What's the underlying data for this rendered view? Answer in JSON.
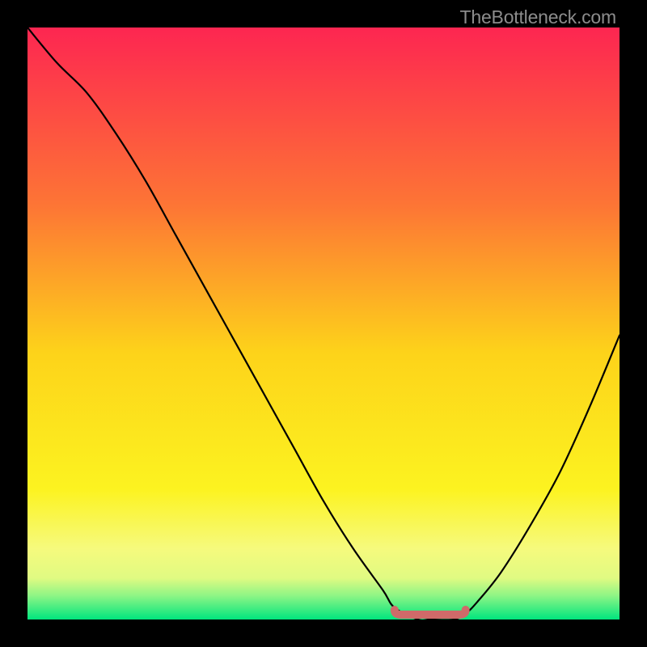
{
  "watermark": "TheBottleneck.com",
  "chart_data": {
    "type": "line",
    "title": "",
    "xlabel": "",
    "ylabel": "",
    "xlim": [
      0,
      100
    ],
    "ylim": [
      0,
      100
    ],
    "x": [
      0,
      5,
      10,
      15,
      20,
      25,
      30,
      35,
      40,
      45,
      50,
      55,
      60,
      62,
      66,
      68,
      72,
      74,
      76,
      80,
      85,
      90,
      95,
      100
    ],
    "y": [
      100,
      94,
      89,
      82,
      74,
      65,
      56,
      47,
      38,
      29,
      20,
      12,
      5,
      2,
      0,
      0,
      0,
      1,
      3,
      8,
      16,
      25,
      36,
      48
    ],
    "flat_region": {
      "x_start": 62,
      "x_end": 74,
      "y": 0
    },
    "background_gradient_top_to_bottom": [
      {
        "stop": 0.0,
        "color": "#fd2651"
      },
      {
        "stop": 0.3,
        "color": "#fd7535"
      },
      {
        "stop": 0.55,
        "color": "#fdd31a"
      },
      {
        "stop": 0.78,
        "color": "#fcf320"
      },
      {
        "stop": 0.88,
        "color": "#f6fa7d"
      },
      {
        "stop": 0.93,
        "color": "#e0fa82"
      },
      {
        "stop": 0.96,
        "color": "#8df585"
      },
      {
        "stop": 1.0,
        "color": "#00e57e"
      }
    ],
    "flat_marker_color": "#d06a69"
  }
}
